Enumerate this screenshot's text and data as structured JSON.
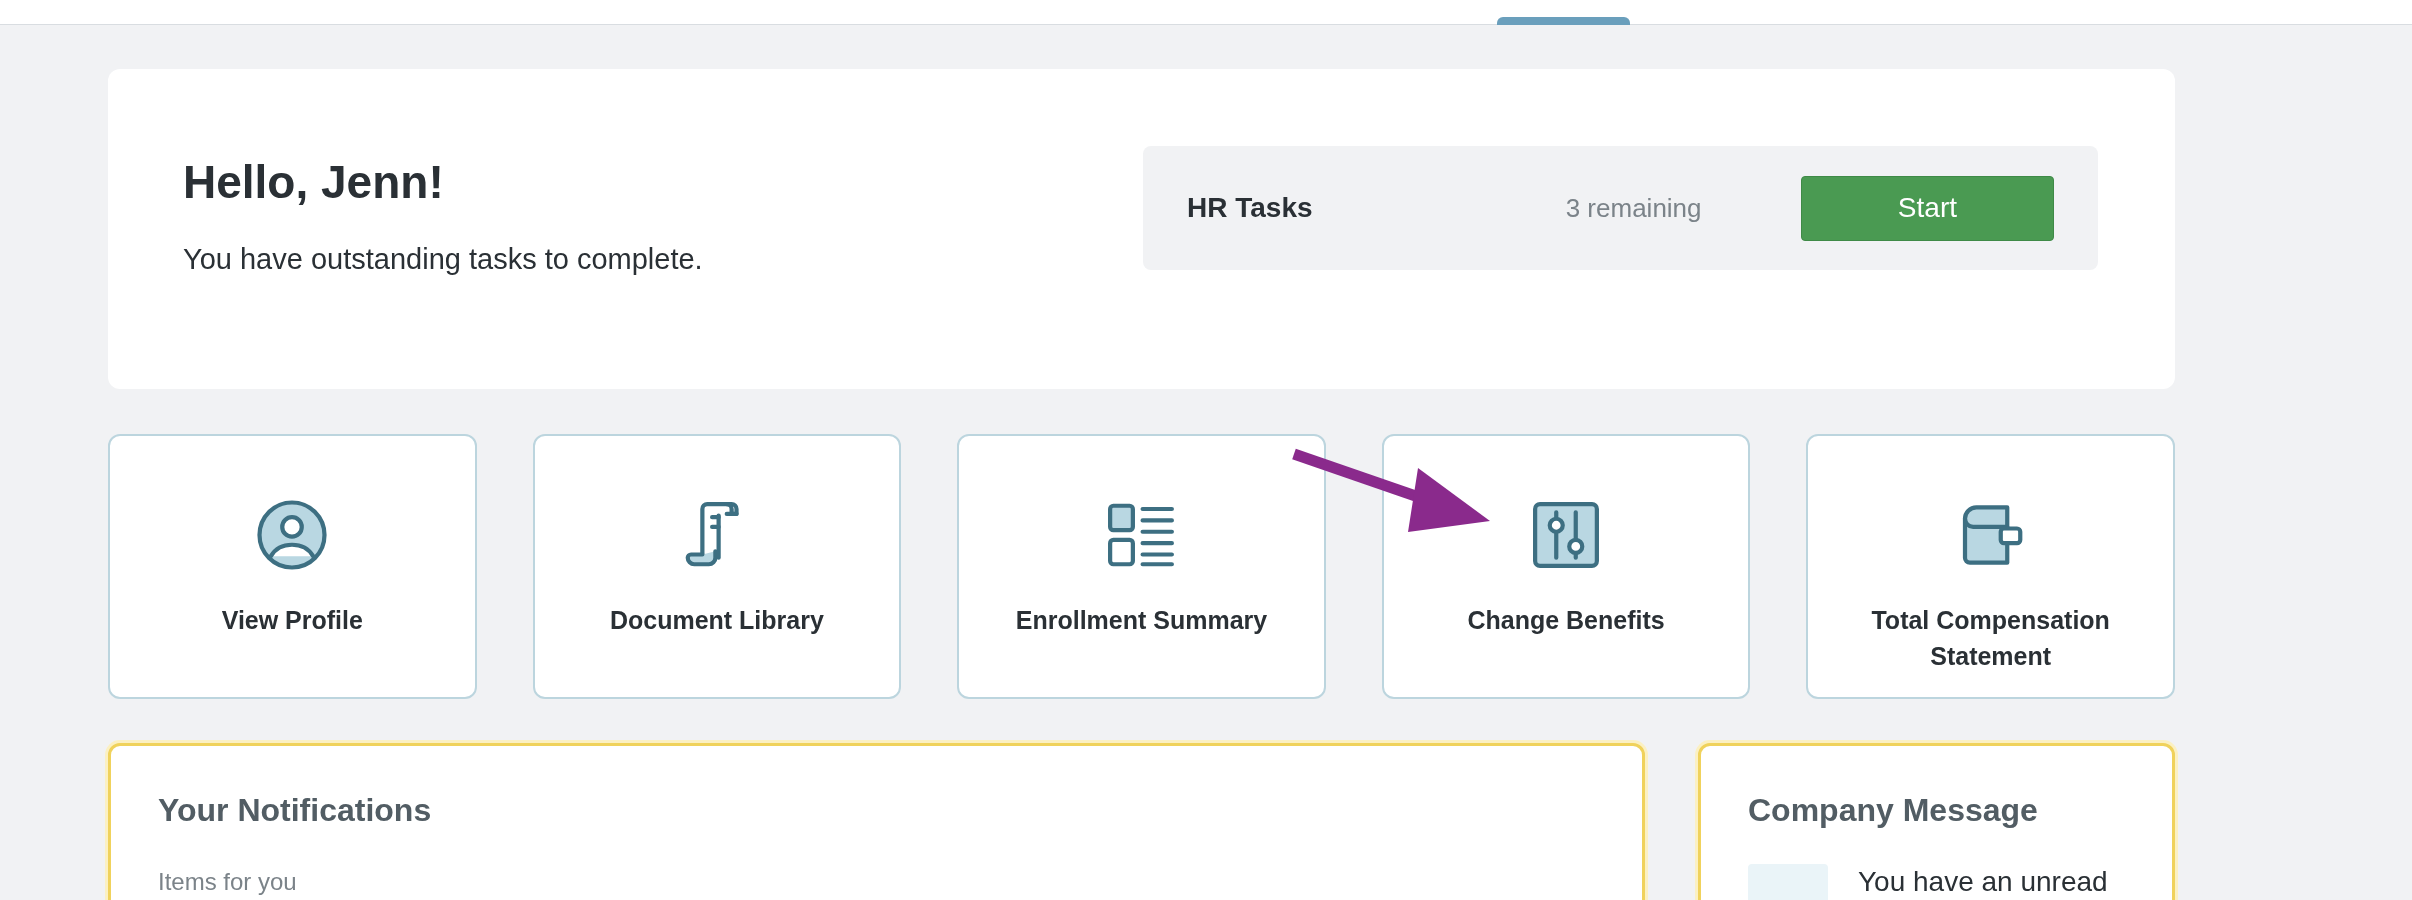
{
  "greeting": {
    "title": "Hello, Jenn!",
    "message": "You have outstanding tasks to complete."
  },
  "hr_tasks": {
    "label": "HR Tasks",
    "count": "3 remaining",
    "button": "Start"
  },
  "tiles": [
    {
      "kind": "profile",
      "label": "View Profile"
    },
    {
      "kind": "document",
      "label": "Document Library"
    },
    {
      "kind": "summary",
      "label": "Enrollment Summary"
    },
    {
      "kind": "benefits",
      "label": "Change Benefits",
      "highlighted": true
    },
    {
      "kind": "wallet",
      "label": "Total Compensation Statement"
    }
  ],
  "notifications": {
    "title": "Your Notifications",
    "subtitle": "Items for you"
  },
  "company_message": {
    "title": "Company Message",
    "text": "You have an unread"
  }
}
